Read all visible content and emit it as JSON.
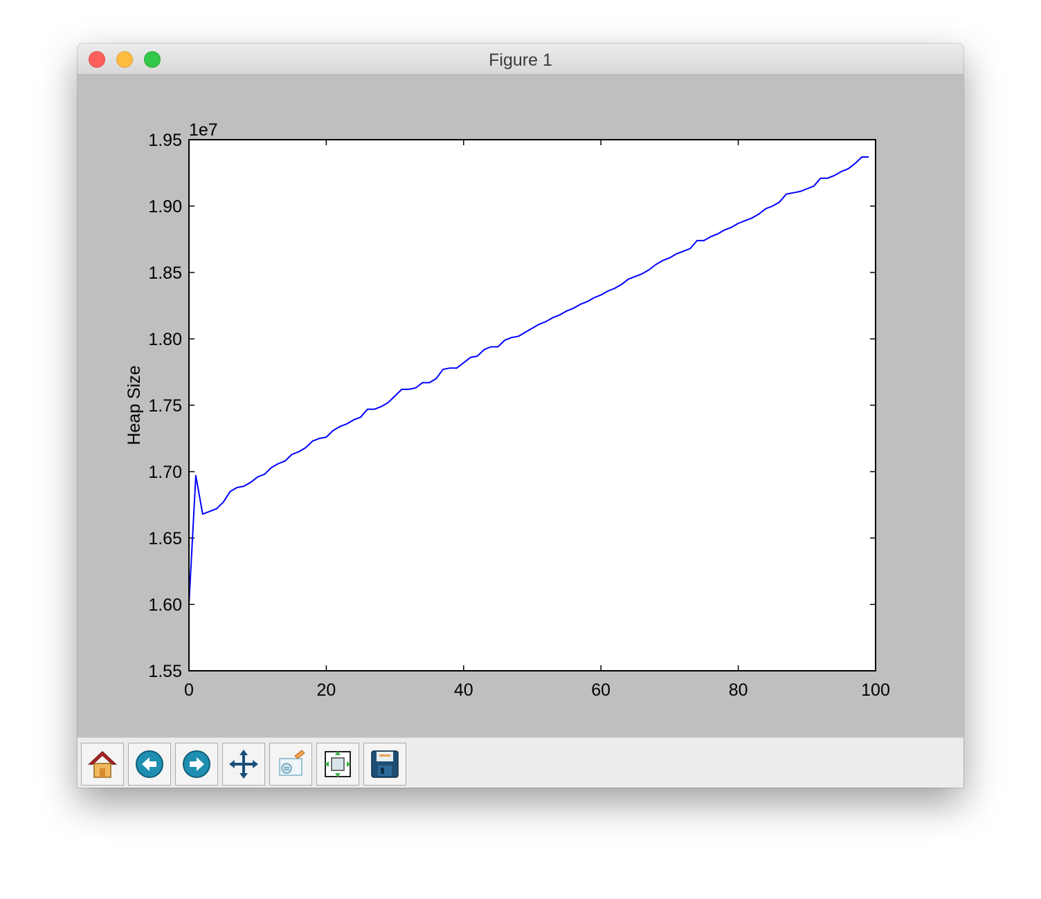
{
  "window": {
    "title": "Figure 1"
  },
  "toolbar": {
    "buttons": [
      {
        "name": "home",
        "icon": "home-icon"
      },
      {
        "name": "back",
        "icon": "back-arrow-icon"
      },
      {
        "name": "forward",
        "icon": "forward-arrow-icon"
      },
      {
        "name": "pan",
        "icon": "pan-arrows-icon"
      },
      {
        "name": "zoom",
        "icon": "zoom-rect-icon"
      },
      {
        "name": "subplots",
        "icon": "subplots-config-icon"
      },
      {
        "name": "save",
        "icon": "floppy-disk-icon"
      }
    ]
  },
  "chart_data": {
    "type": "line",
    "title": "",
    "xlabel": "",
    "ylabel": "Heap Size",
    "offset_label": "1e7",
    "xlim": [
      0,
      100
    ],
    "ylim": [
      1.55,
      1.95
    ],
    "xticks": [
      "0",
      "20",
      "40",
      "60",
      "80",
      "100"
    ],
    "yticks": [
      "1.55",
      "1.60",
      "1.65",
      "1.70",
      "1.75",
      "1.80",
      "1.85",
      "1.90",
      "1.95"
    ],
    "grid": false,
    "line_color": "#0000ff",
    "x": [
      0,
      1,
      2,
      3,
      4,
      5,
      6,
      7,
      8,
      9,
      10,
      11,
      12,
      13,
      14,
      15,
      16,
      17,
      18,
      19,
      20,
      21,
      22,
      23,
      24,
      25,
      26,
      27,
      28,
      29,
      30,
      31,
      32,
      33,
      34,
      35,
      36,
      37,
      38,
      39,
      40,
      41,
      42,
      43,
      44,
      45,
      46,
      47,
      48,
      49,
      50,
      51,
      52,
      53,
      54,
      55,
      56,
      57,
      58,
      59,
      60,
      61,
      62,
      63,
      64,
      65,
      66,
      67,
      68,
      69,
      70,
      71,
      72,
      73,
      74,
      75,
      76,
      77,
      78,
      79,
      80,
      81,
      82,
      83,
      84,
      85,
      86,
      87,
      88,
      89,
      90,
      91,
      92,
      93,
      94,
      95,
      96,
      97,
      98,
      99
    ],
    "y": [
      1.6,
      1.697,
      1.668,
      1.67,
      1.672,
      1.677,
      1.685,
      1.688,
      1.689,
      1.692,
      1.696,
      1.698,
      1.703,
      1.706,
      1.708,
      1.713,
      1.715,
      1.718,
      1.723,
      1.725,
      1.726,
      1.731,
      1.734,
      1.736,
      1.739,
      1.741,
      1.747,
      1.747,
      1.749,
      1.752,
      1.757,
      1.762,
      1.762,
      1.763,
      1.767,
      1.767,
      1.77,
      1.777,
      1.778,
      1.778,
      1.782,
      1.786,
      1.787,
      1.792,
      1.794,
      1.794,
      1.799,
      1.801,
      1.802,
      1.805,
      1.808,
      1.811,
      1.813,
      1.816,
      1.818,
      1.821,
      1.823,
      1.826,
      1.828,
      1.831,
      1.833,
      1.836,
      1.838,
      1.841,
      1.845,
      1.847,
      1.849,
      1.852,
      1.856,
      1.859,
      1.861,
      1.864,
      1.866,
      1.868,
      1.874,
      1.874,
      1.877,
      1.879,
      1.882,
      1.884,
      1.887,
      1.889,
      1.891,
      1.894,
      1.898,
      1.9,
      1.903,
      1.909,
      1.91,
      1.911,
      1.913,
      1.915,
      1.921,
      1.921,
      1.923,
      1.926,
      1.928,
      1.932,
      1.937,
      1.937
    ]
  }
}
